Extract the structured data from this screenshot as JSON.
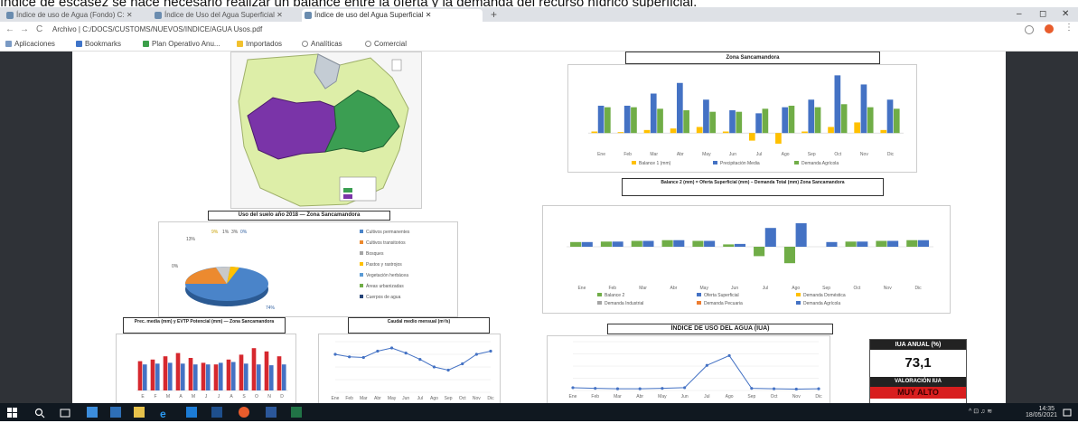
{
  "caption": "índice de escasez se hace necesario realizar un balance entre la oferta y la demanda del recurso hídrico superficial.",
  "browser": {
    "tabs": [
      {
        "label": "Índice de uso de Agua (Fondo) C: ✕"
      },
      {
        "label": "Índice de Uso del Agua Superficial ✕"
      },
      {
        "label": "Índice de uso del Agua Superficial ✕"
      }
    ],
    "new_tab": "+",
    "window_controls": [
      "–",
      "◻",
      "✕"
    ],
    "nav": {
      "back": "←",
      "forward": "→",
      "reload": "C"
    },
    "url": "Archivo | C:/DOCS/CUSTOMS/NUEVOS/INDICE/AGUA Usos.pdf",
    "bookmarks": [
      "Aplicaciones",
      "Bookmarks",
      "Plan Operativo Anu...",
      "Importados",
      "Analíticas",
      "Comercial"
    ]
  },
  "colors": {
    "purple": "#7a34a8",
    "green": "#3b9e52",
    "lightgreen": "#ddeea8",
    "series_blue": "#4472c4",
    "series_grey": "#a5a5a5",
    "series_yellow": "#ffc000",
    "series_green": "#70ad47",
    "series_red": "#d6282e",
    "alert_red": "#d81e1e"
  },
  "pdf": {
    "pie_title": "Uso del suelo año 2018 — Zona Sancamandora",
    "pie_labels": {
      "a": "9%",
      "b": "1%",
      "c": "3%",
      "d": "13%",
      "e": "74%",
      "f": "0%"
    },
    "pie_legend": [
      "Cultivos permanentes",
      "Cultivos transitorios",
      "Bosques",
      "Pastos y rastrojos",
      "Vegetación herbácea",
      "Áreas urbanizadas",
      "Cuerpos de agua"
    ],
    "precip_title": "Prec. media (mm) y EVTP Potencial (mm) — Zona Sancamandora",
    "caudal_title": "Caudal medio mensual (m³/s)",
    "top_chart_title": "Zona Sancamandora",
    "top_chart_legend": [
      "Balance 1 (mm)",
      "Precipitación Media",
      "Demanda Agrícola"
    ],
    "balance_title": "Balance 2 (mm) = Oferta Superficial (mm) – Demanda Total (mm) Zona Sancamandora",
    "balance_legend": [
      "Balance 2",
      "Oferta Superficial",
      "Demanda Doméstica",
      "Demanda Industrial",
      "Demanda Pecuaria",
      "Demanda Agrícola"
    ],
    "iua_chart_title": "ÍNDICE DE USO DEL AGUA (IUA)",
    "iua_box": {
      "label": "IUA ANUAL (%)",
      "value": "73,1",
      "valuation_label": "VALORACIÓN IUA",
      "valuation": "MUY ALTO"
    }
  },
  "chart_data": [
    {
      "type": "bar",
      "title": "Zona Sancamandora",
      "categories": [
        "Ene",
        "Feb",
        "Mar",
        "Abr",
        "May",
        "Jun",
        "Jul",
        "Ago",
        "Sep",
        "Oct",
        "Nov",
        "Dic"
      ],
      "ylim": [
        -50,
        200
      ],
      "series": [
        {
          "name": "Balance 1 (mm)",
          "values": [
            5,
            3,
            10,
            15,
            20,
            5,
            -25,
            -35,
            5,
            20,
            35,
            10
          ]
        },
        {
          "name": "Precipitación Media",
          "values": [
            90,
            90,
            130,
            165,
            110,
            75,
            65,
            85,
            110,
            190,
            160,
            110
          ]
        },
        {
          "name": "Demanda Agrícola",
          "values": [
            85,
            85,
            80,
            75,
            70,
            70,
            80,
            90,
            85,
            95,
            85,
            80
          ]
        }
      ]
    },
    {
      "type": "bar",
      "title": "Balance 2 (mm) = Oferta Superficial (mm) – Demanda Total (mm) Zona Sancamandora",
      "categories": [
        "Ene",
        "Feb",
        "Mar",
        "Abr",
        "May",
        "Jun",
        "Jul",
        "Ago",
        "Sep",
        "Oct",
        "Nov",
        "Dic"
      ],
      "ylim": [
        -150,
        150
      ],
      "series": [
        {
          "name": "Balance 2",
          "values": [
            20,
            22,
            25,
            28,
            25,
            10,
            -40,
            -70,
            0,
            22,
            25,
            28
          ]
        },
        {
          "name": "Oferta Superficial",
          "values": [
            20,
            22,
            25,
            28,
            25,
            12,
            80,
            100,
            20,
            22,
            25,
            28
          ]
        }
      ]
    },
    {
      "type": "bar",
      "title": "Prec. media (mm) y EVTP Potencial (mm) — Zona Sancamandora",
      "categories": [
        "E",
        "F",
        "M",
        "A",
        "M",
        "J",
        "J",
        "A",
        "S",
        "O",
        "N",
        "D"
      ],
      "ylim": [
        0,
        300
      ],
      "series": [
        {
          "name": "Prec. media",
          "values": [
            180,
            190,
            210,
            230,
            200,
            170,
            160,
            190,
            220,
            260,
            240,
            210
          ]
        },
        {
          "name": "EVTP Potencial",
          "values": [
            160,
            165,
            170,
            165,
            160,
            160,
            170,
            175,
            165,
            160,
            155,
            160
          ]
        }
      ]
    },
    {
      "type": "line",
      "title": "Caudal medio mensual (m³/s)",
      "x": [
        "Ene",
        "Feb",
        "Mar",
        "Abr",
        "May",
        "Jun",
        "Jul",
        "Ago",
        "Sep",
        "Oct",
        "Nov",
        "Dic"
      ],
      "ylim": [
        0,
        8
      ],
      "series": [
        {
          "name": "Caudal",
          "values": [
            6.0,
            5.6,
            5.5,
            6.5,
            7.0,
            6.2,
            5.2,
            4.0,
            3.5,
            4.5,
            6.0,
            6.5
          ]
        }
      ]
    },
    {
      "type": "line",
      "title": "ÍNDICE DE USO DEL AGUA (IUA)",
      "x": [
        "Ene",
        "Feb",
        "Mar",
        "Abr",
        "May",
        "Jun",
        "Jul",
        "Ago",
        "Sep",
        "Oct",
        "Nov",
        "Dic"
      ],
      "ylim": [
        0,
        350
      ],
      "series": [
        {
          "name": "IUA",
          "values": [
            20,
            15,
            12,
            12,
            15,
            20,
            180,
            250,
            15,
            12,
            10,
            12
          ]
        }
      ]
    }
  ]
}
